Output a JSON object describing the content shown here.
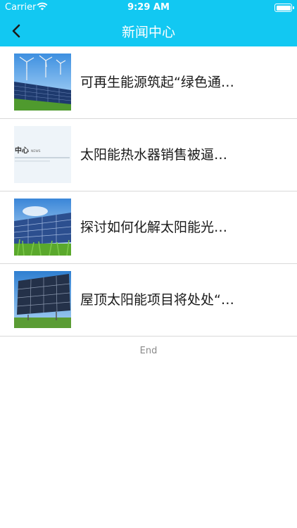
{
  "status": {
    "carrier": "Carrier",
    "time": "9:29 AM"
  },
  "nav": {
    "title": "新闻中心"
  },
  "news": [
    {
      "title": "可再生能源筑起“绿色通…"
    },
    {
      "title": "太阳能热水器销售被逼…",
      "thumb_text": "中心",
      "thumb_text_small": "NEWS"
    },
    {
      "title": "探讨如何化解太阳能光…"
    },
    {
      "title": "屋顶太阳能项目将处处“…"
    }
  ],
  "footer": {
    "end_label": "End"
  },
  "colors": {
    "accent": "#12c8f2"
  }
}
